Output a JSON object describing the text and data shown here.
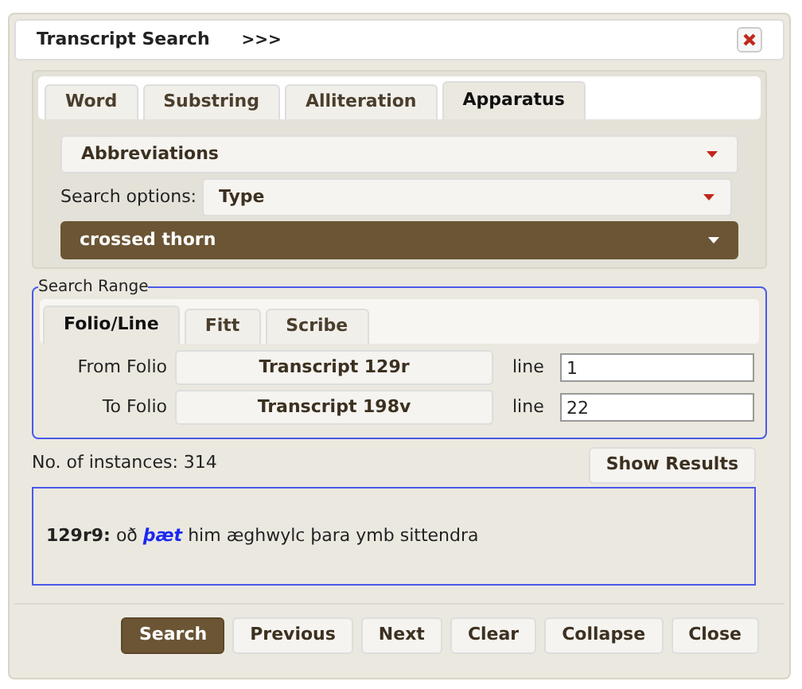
{
  "window": {
    "title": "Transcript Search",
    "toggle": ">>>"
  },
  "search_tabs": [
    {
      "label": "Word",
      "selected": false
    },
    {
      "label": "Substring",
      "selected": false
    },
    {
      "label": "Alliteration",
      "selected": false
    },
    {
      "label": "Apparatus",
      "selected": true
    }
  ],
  "category_select": {
    "value": "Abbreviations"
  },
  "search_options": {
    "label": "Search options:",
    "value": "Type"
  },
  "type_select": {
    "value": "crossed thorn"
  },
  "search_range": {
    "legend": "Search Range",
    "tabs": [
      {
        "label": "Folio/Line",
        "selected": true
      },
      {
        "label": "Fitt",
        "selected": false
      },
      {
        "label": "Scribe",
        "selected": false
      }
    ],
    "rows": [
      {
        "label": "From Folio",
        "folio": "Transcript 129r",
        "line_label": "line",
        "line": "1"
      },
      {
        "label": "To Folio",
        "folio": "Transcript 198v",
        "line_label": "line",
        "line": "22"
      }
    ]
  },
  "instances": "No. of instances: 314",
  "show_results": "Show Results",
  "results": [
    {
      "ref": "129r9:",
      "before": "oð",
      "match": "þæt",
      "after": "him æghwylc þara ymb sittendra"
    }
  ],
  "buttons": [
    {
      "label": "Search",
      "kind": "primary"
    },
    {
      "label": "Previous",
      "kind": "default"
    },
    {
      "label": "Next",
      "kind": "default"
    },
    {
      "label": "Clear",
      "kind": "default"
    },
    {
      "label": "Collapse",
      "kind": "default"
    },
    {
      "label": "Close",
      "kind": "default"
    }
  ]
}
